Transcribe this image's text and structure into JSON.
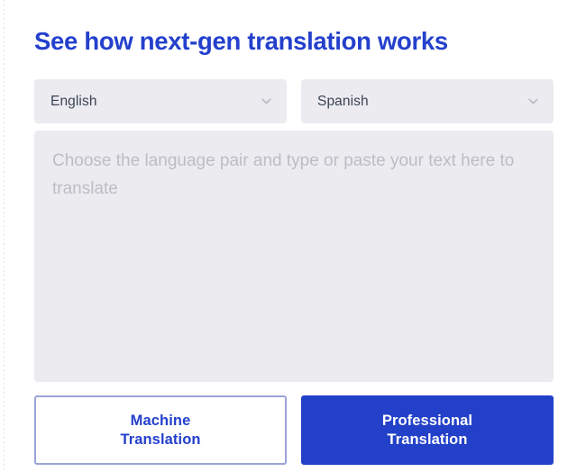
{
  "page": {
    "background_color": "#ffffff",
    "accent_color": "#2440cc",
    "primary_button_color": "#2341c8",
    "field_background_color": "#ecebf0"
  },
  "header": {
    "title": "See how next-gen translation works"
  },
  "language_pair": {
    "source": {
      "label": "source-language",
      "value": "English",
      "icon": "chevron-down-icon"
    },
    "target": {
      "label": "target-language",
      "value": "Spanish",
      "icon": "chevron-down-icon"
    }
  },
  "editor": {
    "value": "",
    "placeholder": "Choose the language pair and type or paste your text here to translate"
  },
  "actions": {
    "machine": {
      "line1": "Machine",
      "line2": "Translation"
    },
    "professional": {
      "line1": "Professional",
      "line2": "Translation"
    }
  }
}
